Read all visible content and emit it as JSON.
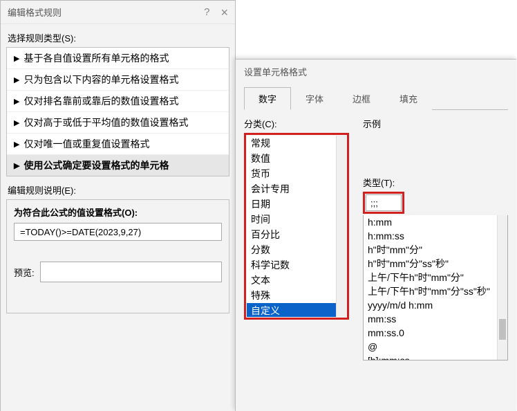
{
  "dlgLeft": {
    "title": "编辑格式规则",
    "selectLbl": "选择规则类型(S):",
    "rules": [
      "基于各自值设置所有单元格的格式",
      "只为包含以下内容的单元格设置格式",
      "仅对排名靠前或靠后的数值设置格式",
      "仅对高于或低于平均值的数值设置格式",
      "仅对唯一值或重复值设置格式",
      "使用公式确定要设置格式的单元格"
    ],
    "selectedRule": 5,
    "editLbl": "编辑规则说明(E):",
    "formulaLbl": "为符合此公式的值设置格式(O):",
    "formula": "=TODAY()>=DATE(2023,9,27)",
    "previewLbl": "预览:"
  },
  "dlgRight": {
    "title": "设置单元格格式",
    "tabs": [
      "数字",
      "字体",
      "边框",
      "填充"
    ],
    "activeTab": 0,
    "categoryLbl": "分类(C):",
    "categories": [
      "常规",
      "数值",
      "货币",
      "会计专用",
      "日期",
      "时间",
      "百分比",
      "分数",
      "科学记数",
      "文本",
      "特殊",
      "自定义"
    ],
    "selectedCategory": 11,
    "exampleLbl": "示例",
    "typeLbl": "类型(T):",
    "typeInput": ";;;",
    "typeList": [
      "h:mm",
      "h:mm:ss",
      "h\"时\"mm\"分\"",
      "h\"时\"mm\"分\"ss\"秒\"",
      "上午/下午h\"时\"mm\"分\"",
      "上午/下午h\"时\"mm\"分\"ss\"秒\"",
      "yyyy/m/d h:mm",
      "mm:ss",
      "mm:ss.0",
      "@",
      "[h]:mm:ss",
      ";;;"
    ],
    "selectedType": 11
  }
}
